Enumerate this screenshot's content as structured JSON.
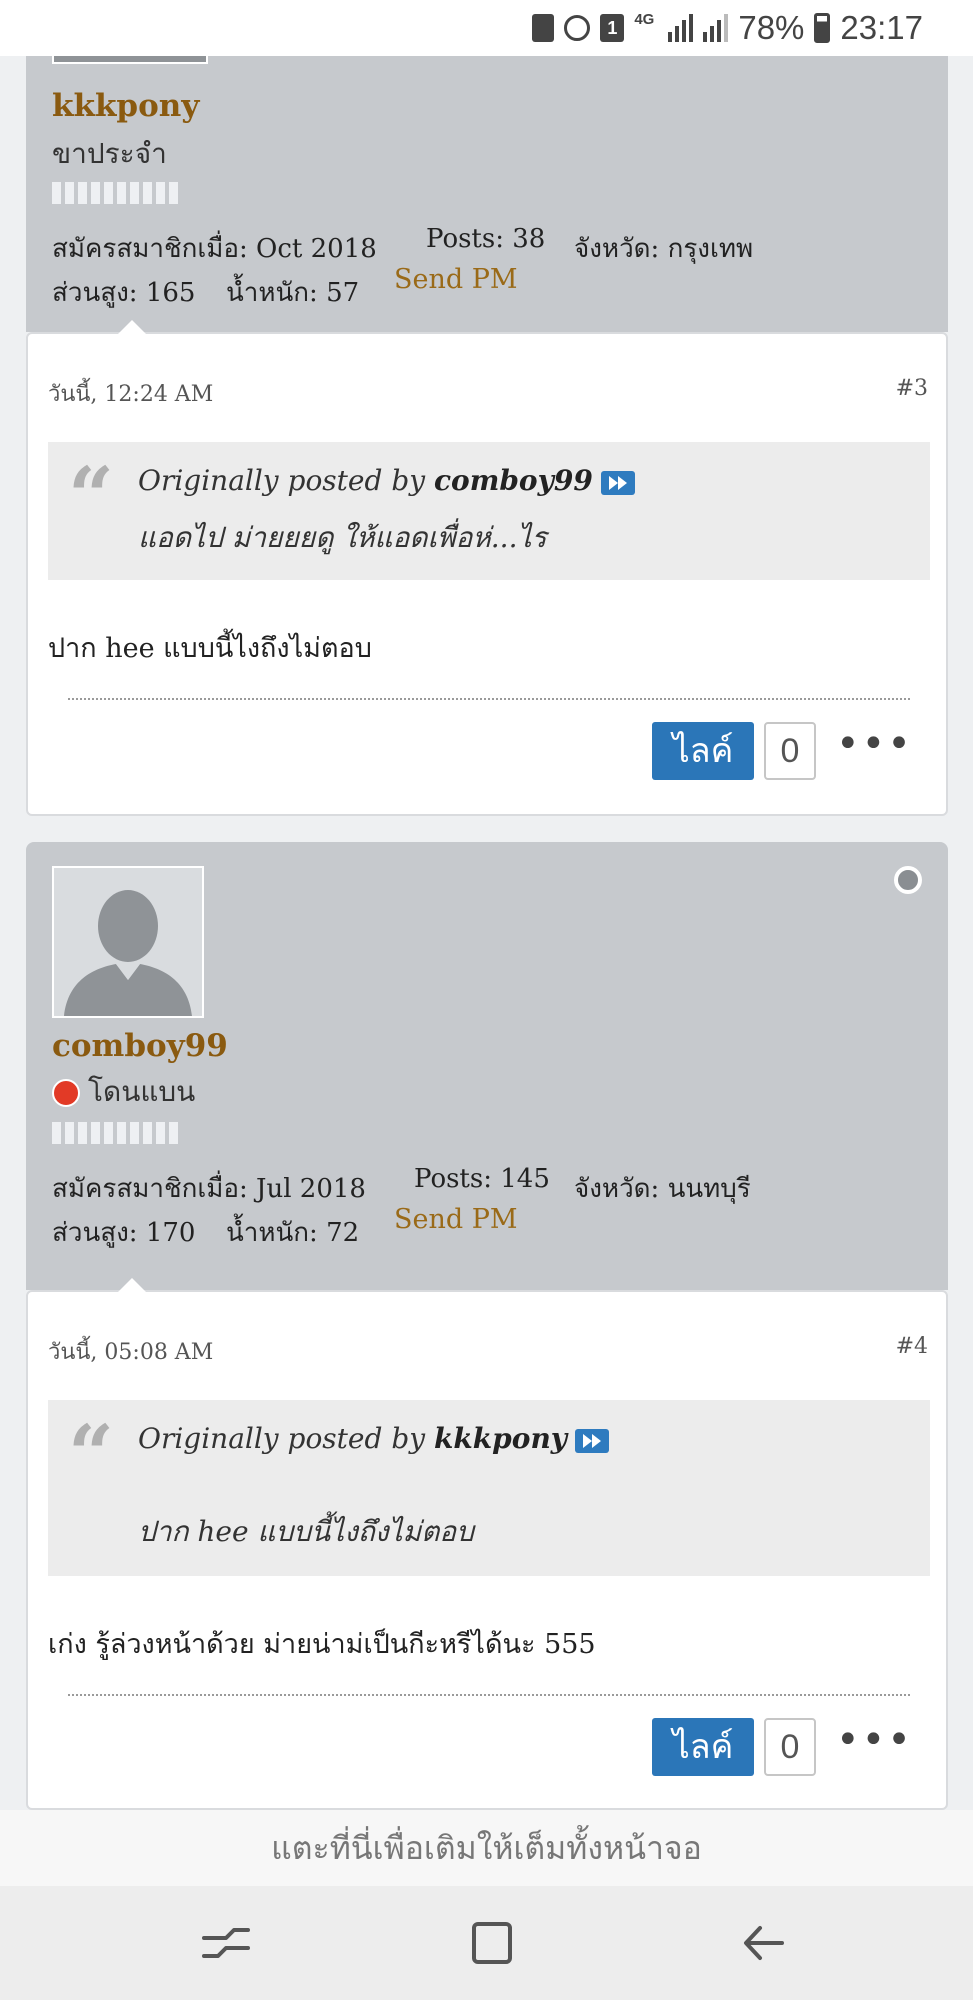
{
  "status_bar": {
    "icons": [
      "recycle-icon",
      "alarm-icon",
      "sim-icon",
      "network-icon",
      "signal-icon",
      "signal-icon",
      "battery-icon"
    ],
    "sim_label": "1",
    "network_label": "4G",
    "battery": "78%",
    "time": "23:17"
  },
  "posts": [
    {
      "username": "kkkpony",
      "user_title": "ขาประจำ",
      "joined_label": "สมัครสมาชิกเมื่อ:",
      "joined_value": "Oct 2018",
      "posts_label": "Posts:",
      "posts_value": "38",
      "province_label": "จังหวัด:",
      "province_value": "กรุงเทพ",
      "height_label": "ส่วนสูง:",
      "height_value": "165",
      "weight_label": "น้ำหนัก:",
      "weight_value": "57",
      "send_pm": "Send PM",
      "date": "วันนี้, 12:24 AM",
      "post_number": "#3",
      "quote_prefix": "Originally posted by",
      "quote_author": "comboy99",
      "quote_text": "แอดไป ม่ายยยดู ให้แอดเพื่อห่...ไร",
      "message": "ปาก hee แบบนี้ไงถึงไม่ตอบ",
      "like_label": "ไลค์",
      "like_count": "0",
      "more_label": "•••"
    },
    {
      "username": "comboy99",
      "user_title": "โดนแบน",
      "joined_label": "สมัครสมาชิกเมื่อ:",
      "joined_value": "Jul 2018",
      "posts_label": "Posts:",
      "posts_value": "145",
      "province_label": "จังหวัด:",
      "province_value": "นนทบุรี",
      "height_label": "ส่วนสูง:",
      "height_value": "170",
      "weight_label": "น้ำหนัก:",
      "weight_value": "72",
      "send_pm": "Send PM",
      "date": "วันนี้, 05:08 AM",
      "post_number": "#4",
      "quote_prefix": "Originally posted by",
      "quote_author": "kkkpony",
      "quote_text": "ปาก hee แบบนี้ไงถึงไม่ตอบ",
      "message": "เก่ง รู้ล่วงหน้าด้วย ม่ายน่าม่เป็นกีะหรีได้นะ 555",
      "like_label": "ไลค์",
      "like_count": "0",
      "more_label": "•••"
    }
  ],
  "fullscreen_prompt": "แตะที่นี่เพื่อเติมให้เต็มทั้งหน้าจอ",
  "navigation": {
    "icons": [
      "recent-apps-icon",
      "home-icon",
      "back-icon"
    ]
  },
  "colors": {
    "username": "#8a5a10",
    "like_button": "#2b76b8",
    "user_block_bg": "#c6c9cd",
    "ban_indicator": "#e23a26"
  }
}
